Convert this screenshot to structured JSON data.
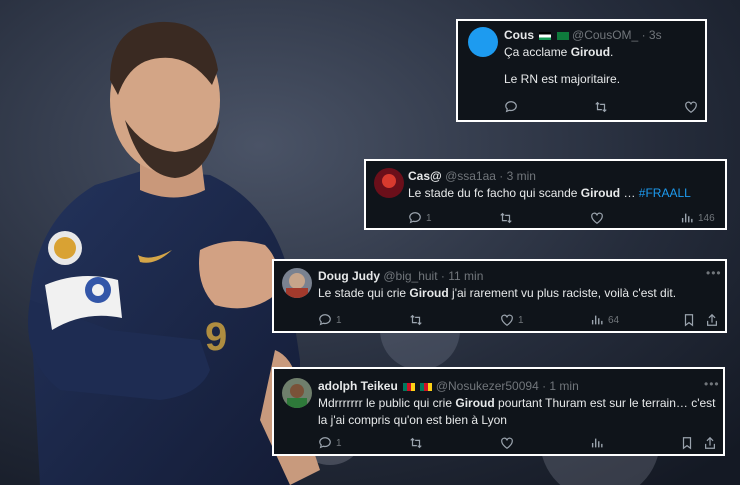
{
  "tweets": [
    {
      "name": "Cous",
      "handle": "@CousOM_",
      "time": "· 3s",
      "lines": [
        {
          "pre": "Ça acclame ",
          "bold": "Giroud",
          "post": "."
        },
        {
          "pre": "Le RN est majoritaire.",
          "bold": "",
          "post": ""
        }
      ],
      "flags": [
        "flag-palestine",
        "flag-saudi"
      ]
    },
    {
      "name": "Cas@",
      "handle": "@ssa1aa",
      "time": "· 3 min",
      "lines": [
        {
          "pre": "Le stade du fc facho qui scande ",
          "bold": "Giroud",
          "post": " … ",
          "tag": "#FRAALL"
        }
      ],
      "replies": "1",
      "views": "146"
    },
    {
      "name": "Doug Judy",
      "handle": "@big_huit",
      "time": "· 11 min",
      "lines": [
        {
          "pre": "Le stade qui crie ",
          "bold": "Giroud",
          "post": " j'ai rarement vu plus raciste, voilà c'est dit."
        }
      ],
      "replies": "1",
      "likes": "1",
      "views": "64"
    },
    {
      "name": "adolph Teikeu",
      "handle": "@Nosukezer50094",
      "time": "· 1 min",
      "lines": [
        {
          "pre": "Mdrrrrrrr le public qui crie ",
          "bold": "Giroud",
          "post": " pourtant Thuram est sur le terrain… c'est"
        },
        {
          "pre": "la j'ai compris qu'on est bien à Lyon",
          "bold": "",
          "post": ""
        }
      ],
      "replies": "1",
      "flags": [
        "flag-cameroon",
        "flag-cameroon"
      ]
    }
  ],
  "icons": {
    "reply": "reply-icon",
    "retweet": "retweet-icon",
    "like": "like-icon",
    "views": "views-icon",
    "bookmark": "bookmark-icon",
    "share": "share-icon",
    "more": "more-icon"
  },
  "colors": {
    "card_bg": "#0f141a",
    "text": "#e7e9ea",
    "muted": "#71767b",
    "link": "#1d9bf0",
    "jersey": "#1c2a4e",
    "avatar_blue": "#1d9bf0"
  }
}
